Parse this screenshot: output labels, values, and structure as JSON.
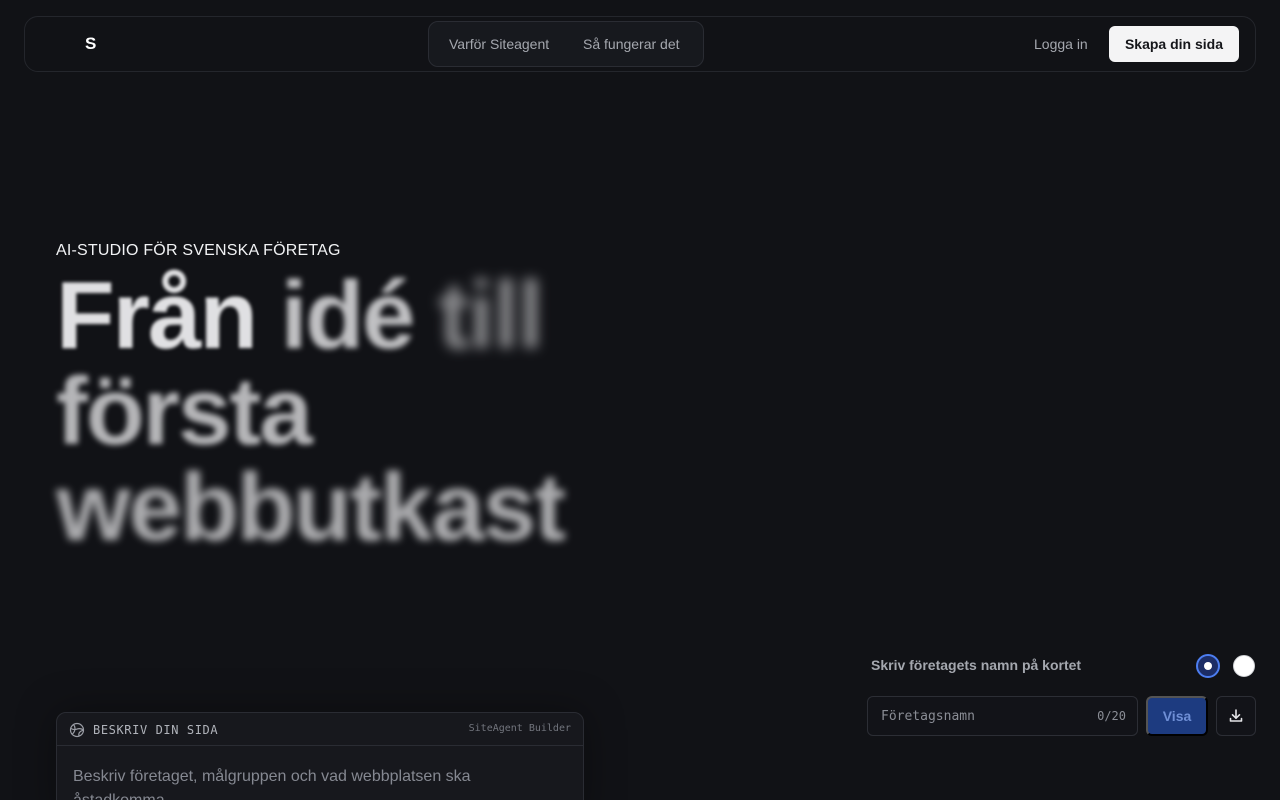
{
  "nav": {
    "logo": "S",
    "links": [
      "Varför Siteagent",
      "Så fungerar det"
    ],
    "login": "Logga in",
    "cta": "Skapa din sida"
  },
  "hero": {
    "eyebrow": "AI-STUDIO FÖR SVENSKA FÖRETAG",
    "headline": [
      "Från",
      "idé",
      "till",
      "första",
      "webbutkast"
    ]
  },
  "builder": {
    "title": "BESKRIV DIN SIDA",
    "tag": "SiteAgent Builder",
    "placeholder": "Beskriv företaget, målgruppen och vad webbplatsen ska åstadkomma."
  },
  "card_preview": {
    "label": "Skriv företagets namn på kortet",
    "input_placeholder": "Företagsnamn",
    "counter": "0/20",
    "show_button": "Visa",
    "themes": [
      {
        "name": "dark",
        "color": "#1c2d66",
        "selected": true
      },
      {
        "name": "light",
        "color": "#ffffff",
        "selected": false
      }
    ]
  },
  "colors": {
    "background": "#111216",
    "accent": "#4c7df0",
    "button_primary": "#f4f4f5",
    "button_blue": "#1d3b80"
  }
}
